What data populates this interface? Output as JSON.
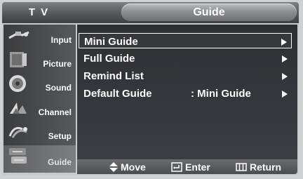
{
  "header": {
    "device_title": "T V",
    "menu_title": "Guide"
  },
  "sidebar": {
    "items": [
      {
        "label": "Input",
        "icon": "input-icon"
      },
      {
        "label": "Picture",
        "icon": "picture-icon"
      },
      {
        "label": "Sound",
        "icon": "sound-icon"
      },
      {
        "label": "Channel",
        "icon": "channel-icon"
      },
      {
        "label": "Setup",
        "icon": "setup-icon"
      },
      {
        "label": "Guide",
        "icon": "guide-icon",
        "active": true
      }
    ]
  },
  "menu": {
    "items": [
      {
        "label": "Mini Guide",
        "value": "",
        "selected": true
      },
      {
        "label": "Full Guide",
        "value": ""
      },
      {
        "label": "Remind List",
        "value": ""
      },
      {
        "label": "Default Guide",
        "value": ": Mini Guide"
      }
    ]
  },
  "footer": {
    "move": "Move",
    "enter": "Enter",
    "return": "Return"
  },
  "colors": {
    "text": "#ffffff",
    "panel": "#2d2f33",
    "header": "#55575a"
  }
}
